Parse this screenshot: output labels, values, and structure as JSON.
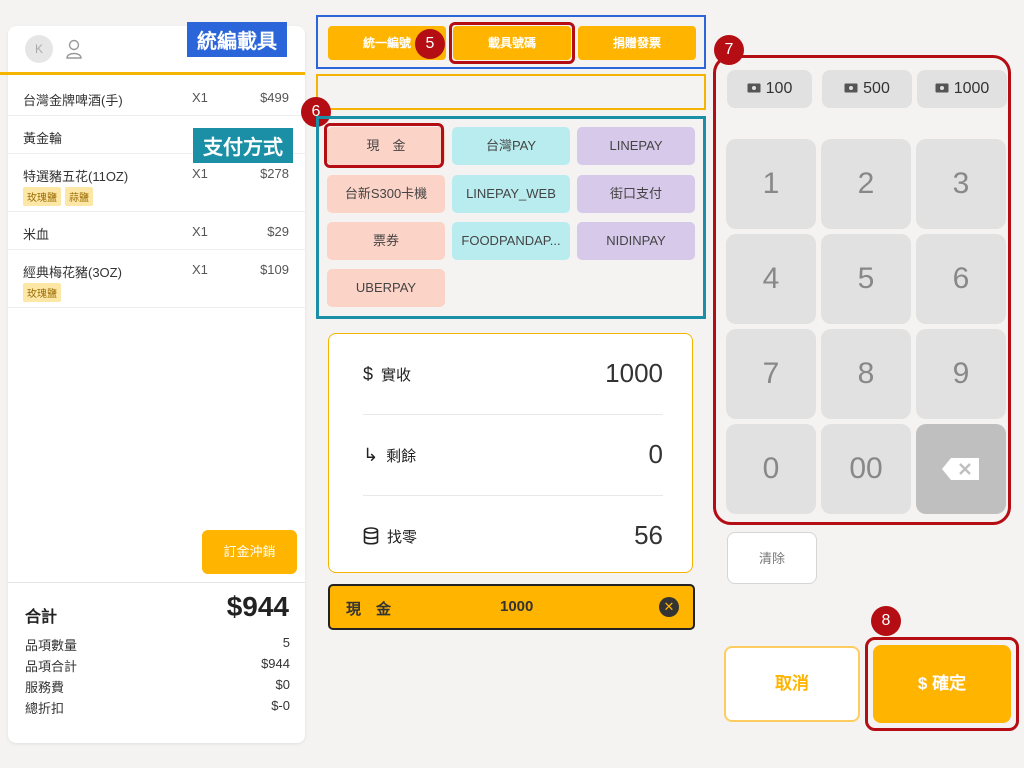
{
  "customer": {
    "avatar_initial": "K"
  },
  "order_items": [
    {
      "name": "台灣金牌啤酒(手)",
      "qty": "X1",
      "price": "$499",
      "tags": []
    },
    {
      "name": "黃金輪",
      "qty": "",
      "price": "",
      "tags": []
    },
    {
      "name": "特選豬五花(11OZ)",
      "qty": "X1",
      "price": "$278",
      "tags": [
        "玫瑰鹽",
        "蒜鹽"
      ]
    },
    {
      "name": "米血",
      "qty": "X1",
      "price": "$29",
      "tags": []
    },
    {
      "name": "經典梅花豬(3OZ)",
      "qty": "X1",
      "price": "$109",
      "tags": [
        "玫瑰鹽"
      ]
    }
  ],
  "deposit_button": "訂金沖銷",
  "summary": {
    "total_label": "合計",
    "total_value": "$944",
    "rows": [
      {
        "label": "品項數量",
        "value": "5"
      },
      {
        "label": "品項合計",
        "value": "$944"
      },
      {
        "label": "服務費",
        "value": "$0"
      },
      {
        "label": "總折扣",
        "value": "$-0"
      }
    ]
  },
  "annotations": {
    "carrier_label": "統編載具",
    "payment_label": "支付方式",
    "badge_5": "5",
    "badge_6": "6",
    "badge_7": "7",
    "badge_8": "8"
  },
  "invoice_options": [
    "統一編號",
    "載具號碼",
    "捐贈發票"
  ],
  "payment_methods": [
    {
      "label": "現　金",
      "color": "pink"
    },
    {
      "label": "台灣PAY",
      "color": "cyan"
    },
    {
      "label": "LINEPAY",
      "color": "lav"
    },
    {
      "label": "台新S300卡機",
      "color": "pink"
    },
    {
      "label": "LINEPAY_WEB",
      "color": "cyan"
    },
    {
      "label": "街口支付",
      "color": "lav"
    },
    {
      "label": "票券",
      "color": "pink"
    },
    {
      "label": "FOODPANDAP...",
      "color": "cyan"
    },
    {
      "label": "NIDINPAY",
      "color": "lav"
    },
    {
      "label": "UBERPAY",
      "color": "pink"
    }
  ],
  "payment_summary": {
    "received_label": "實收",
    "received_value": "1000",
    "remaining_label": "剩餘",
    "remaining_value": "0",
    "change_label": "找零",
    "change_value": "56"
  },
  "cash_strip": {
    "method": "現　金",
    "amount": "1000"
  },
  "quick_cash": [
    "100",
    "500",
    "1000"
  ],
  "keypad": [
    "1",
    "2",
    "3",
    "4",
    "5",
    "6",
    "7",
    "8",
    "9",
    "0",
    "00"
  ],
  "buttons": {
    "clear": "清除",
    "cancel": "取消",
    "confirm": "$ 確定"
  },
  "colors": {
    "accent": "#ffb400",
    "annotation_red": "#b40d13",
    "annotation_blue": "#2a66d9",
    "annotation_teal": "#1b8fa5"
  }
}
